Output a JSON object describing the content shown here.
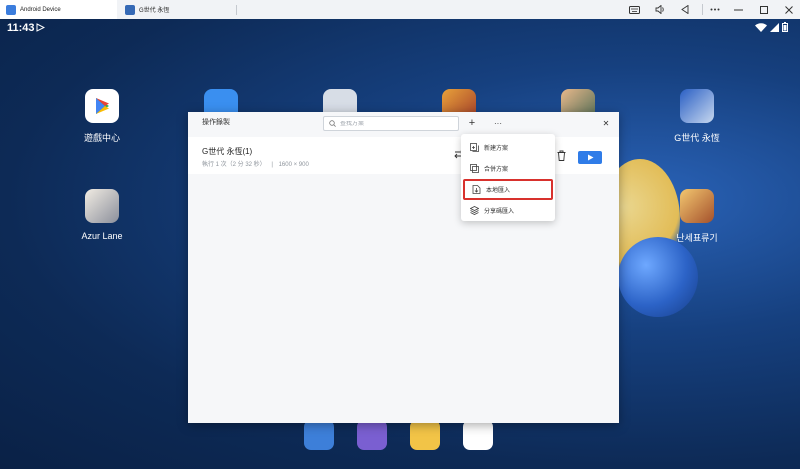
{
  "window": {
    "tabs": [
      {
        "label": "Android Device",
        "active": true
      },
      {
        "label": "G世代 永恆",
        "active": false
      }
    ],
    "controls": [
      "keyboard-icon",
      "volume-icon",
      "back-icon",
      "more-icon",
      "minimize-icon",
      "maximize-icon",
      "close-icon"
    ]
  },
  "statusbar": {
    "time": "11:43"
  },
  "desktop": {
    "apps": [
      {
        "label": "遊戲中心"
      },
      {
        "label": ""
      },
      {
        "label": ""
      },
      {
        "label": ""
      },
      {
        "label": ""
      },
      {
        "label": "G世代 永恆"
      },
      {
        "label": "Azur Lane"
      },
      {
        "label": "난세표류기"
      }
    ]
  },
  "dialog": {
    "title": "操作錄製",
    "search_placeholder": "查找方案",
    "add_symbol": "+",
    "more_symbol": "···",
    "close_symbol": "✕",
    "rows": [
      {
        "title": "G世代 永恆(1)",
        "runs": "執行 1 次（2 分 32 秒）",
        "separator": "|",
        "resolution": "1600 × 900"
      }
    ]
  },
  "menu": {
    "items": [
      {
        "label": "新建方案",
        "highlighted": false
      },
      {
        "label": "合併方案",
        "highlighted": false
      },
      {
        "label": "本地匯入",
        "highlighted": true
      },
      {
        "label": "分享碼匯入",
        "highlighted": false
      }
    ]
  },
  "colors": {
    "accent": "#2f7ce8",
    "highlight": "#d8312d",
    "wallpaper": "#16407f"
  }
}
